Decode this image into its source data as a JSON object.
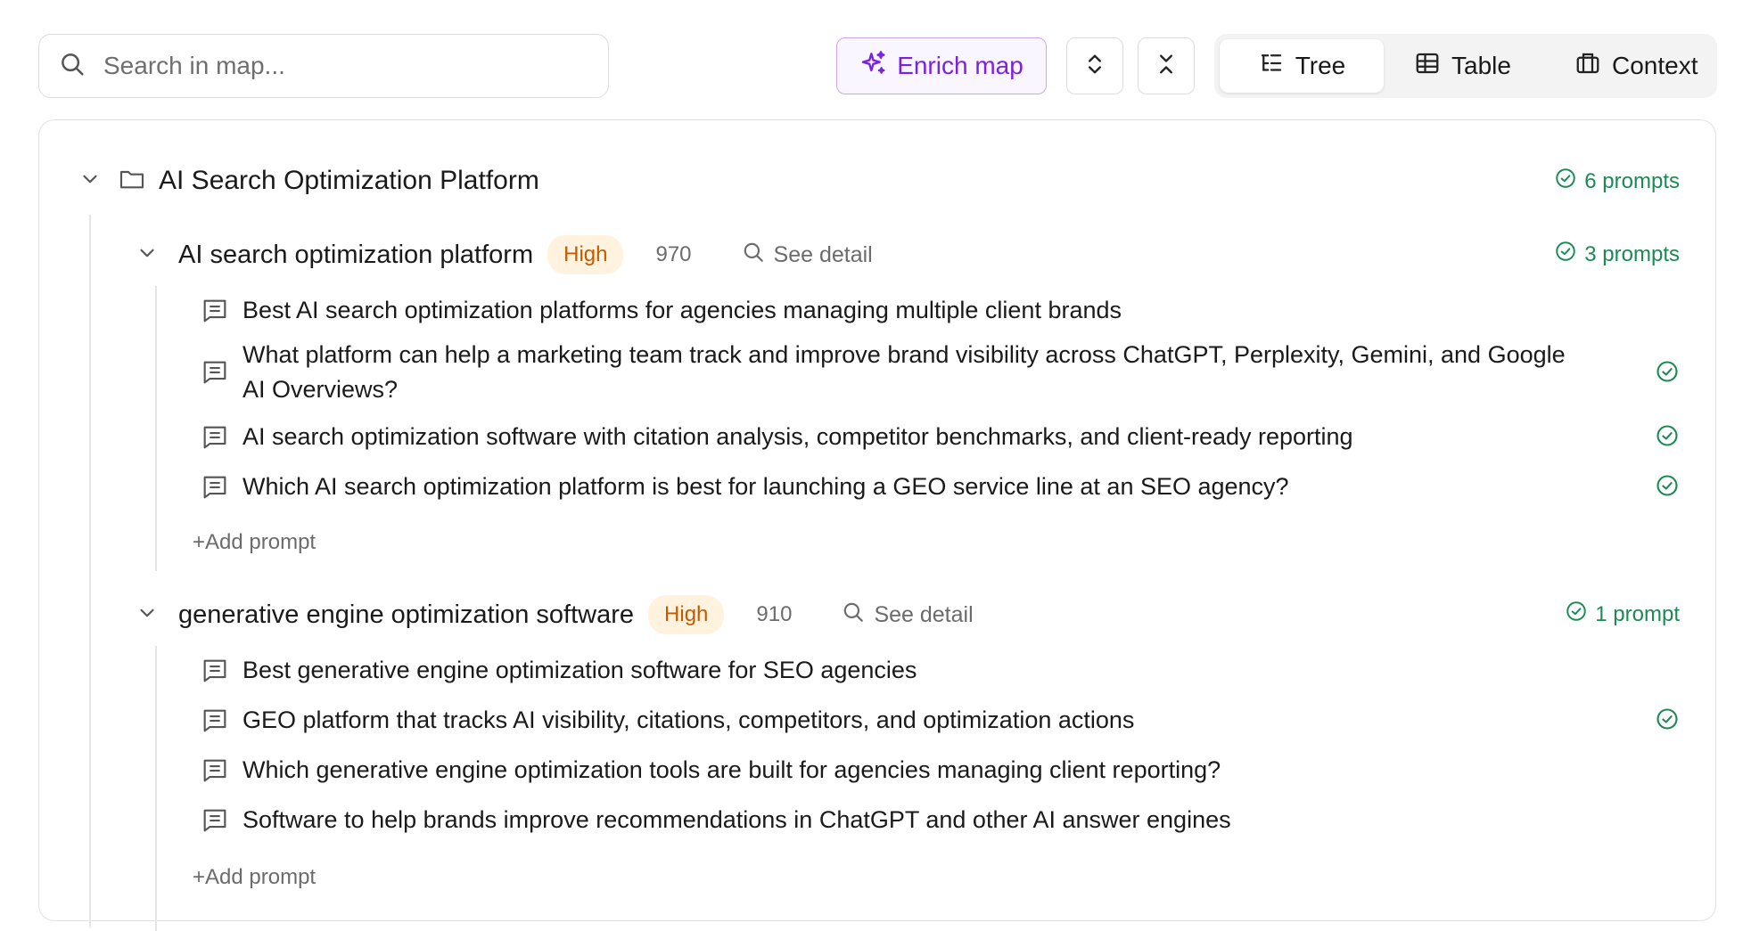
{
  "toolbar": {
    "search_placeholder": "Search in map...",
    "enrich_label": "Enrich map",
    "view_tabs": [
      {
        "label": "Tree",
        "icon": "tree-icon",
        "active": true
      },
      {
        "label": "Table",
        "icon": "table-icon",
        "active": false
      },
      {
        "label": "Context",
        "icon": "context-icon",
        "active": false
      }
    ]
  },
  "root": {
    "title": "AI Search Optimization Platform",
    "count": "6 prompts",
    "groups": [
      {
        "keyword": "AI search optimization platform",
        "priority": "High",
        "volume": "970",
        "detail_label": "See detail",
        "count": "3 prompts",
        "prompts": [
          {
            "text": "Best AI search optimization platforms for agencies managing multiple client brands",
            "checked": false
          },
          {
            "text": "What platform can help a marketing team track and improve brand visibility across ChatGPT, Perplexity, Gemini, and Google AI Overviews?",
            "checked": true
          },
          {
            "text": "AI search optimization software with citation analysis, competitor benchmarks, and client-ready reporting",
            "checked": true
          },
          {
            "text": "Which AI search optimization platform is best for launching a GEO service line at an SEO agency?",
            "checked": true
          }
        ],
        "add_label": "+Add prompt"
      },
      {
        "keyword": "generative engine optimization software",
        "priority": "High",
        "volume": "910",
        "detail_label": "See detail",
        "count": "1 prompt",
        "prompts": [
          {
            "text": "Best generative engine optimization software for SEO agencies",
            "checked": false
          },
          {
            "text": "GEO platform that tracks AI visibility, citations, competitors, and optimization actions",
            "checked": true
          },
          {
            "text": "Which generative engine optimization tools are built for agencies managing client reporting?",
            "checked": false
          },
          {
            "text": "Software to help brands improve recommendations in ChatGPT and other AI answer engines",
            "checked": false
          }
        ],
        "add_label": "+Add prompt"
      }
    ]
  },
  "colors": {
    "accent_purple": "#7a22e0",
    "check_green": "#1b8a55",
    "badge_orange": "#c25a00"
  }
}
